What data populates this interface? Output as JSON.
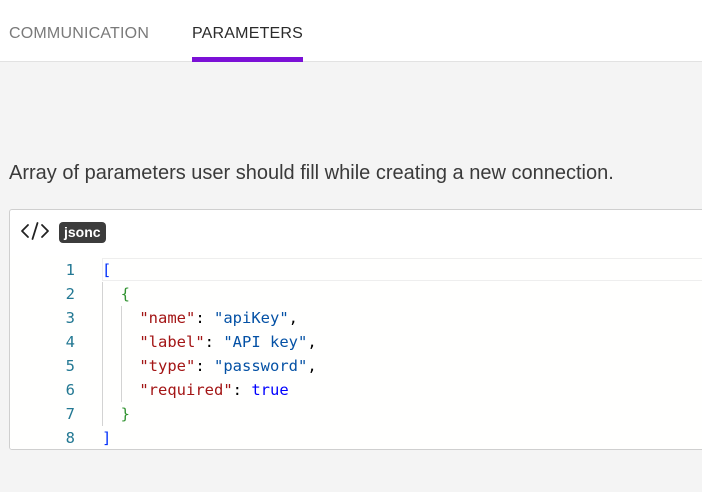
{
  "tabs": [
    {
      "label": "COMMUNICATION",
      "active": false
    },
    {
      "label": "PARAMETERS",
      "active": true
    }
  ],
  "accent_color": "#7b10d6",
  "description": "Array of parameters user should fill while creating a new connection.",
  "code_block": {
    "icon": "code-icon",
    "language": "jsonc",
    "lines": [
      {
        "number": "1",
        "indent": "",
        "tokens": [
          {
            "t": "bracket",
            "v": "["
          }
        ]
      },
      {
        "number": "2",
        "indent": "  ",
        "tokens": [
          {
            "t": "brace",
            "v": "{"
          }
        ]
      },
      {
        "number": "3",
        "indent": "    ",
        "tokens": [
          {
            "t": "key",
            "v": "\"name\""
          },
          {
            "t": "punct",
            "v": ": "
          },
          {
            "t": "str",
            "v": "\"apiKey\""
          },
          {
            "t": "punct",
            "v": ","
          }
        ]
      },
      {
        "number": "4",
        "indent": "    ",
        "tokens": [
          {
            "t": "key",
            "v": "\"label\""
          },
          {
            "t": "punct",
            "v": ": "
          },
          {
            "t": "str",
            "v": "\"API key\""
          },
          {
            "t": "punct",
            "v": ","
          }
        ]
      },
      {
        "number": "5",
        "indent": "    ",
        "tokens": [
          {
            "t": "key",
            "v": "\"type\""
          },
          {
            "t": "punct",
            "v": ": "
          },
          {
            "t": "str",
            "v": "\"password\""
          },
          {
            "t": "punct",
            "v": ","
          }
        ]
      },
      {
        "number": "6",
        "indent": "    ",
        "tokens": [
          {
            "t": "key",
            "v": "\"required\""
          },
          {
            "t": "punct",
            "v": ": "
          },
          {
            "t": "bool",
            "v": "true"
          }
        ]
      },
      {
        "number": "7",
        "indent": "  ",
        "tokens": [
          {
            "t": "brace",
            "v": "}"
          }
        ]
      },
      {
        "number": "8",
        "indent": "",
        "tokens": [
          {
            "t": "bracket",
            "v": "]"
          }
        ]
      }
    ]
  }
}
